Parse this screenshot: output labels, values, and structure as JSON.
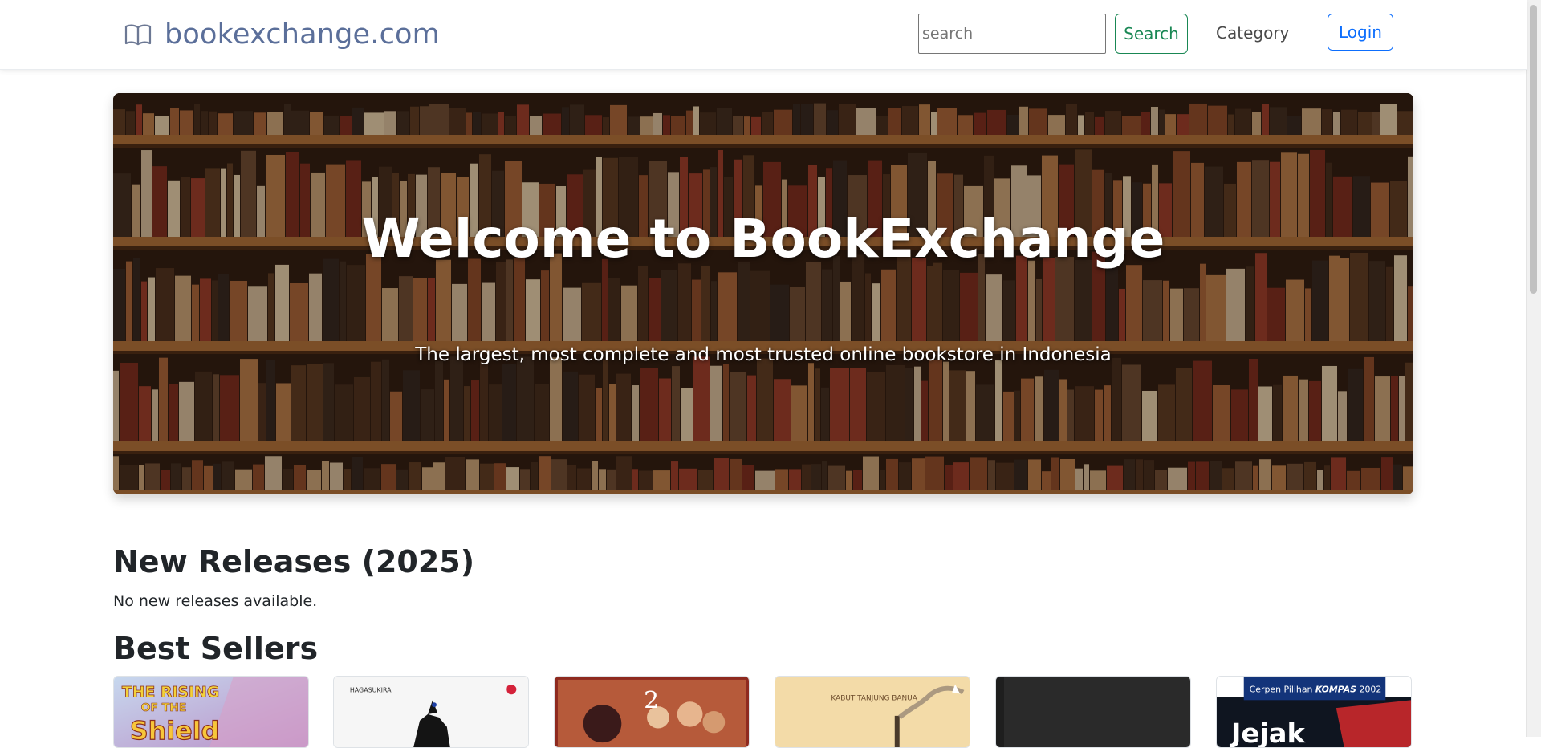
{
  "navbar": {
    "brand_icon": "open-book-icon",
    "brand_name": "bookexchange.com",
    "search_placeholder": "search",
    "search_button": "Search",
    "category_link": "Category",
    "login_button": "Login",
    "brand_color": "#5b6f9a",
    "search_color": "#198754",
    "login_color": "#0d6efd"
  },
  "hero": {
    "title": "Welcome to BookExchange",
    "subtitle": "The largest, most complete and most trusted online bookstore in Indonesia"
  },
  "new_releases": {
    "heading": "New Releases (2025)",
    "empty_message": "No new releases available."
  },
  "best_sellers": {
    "heading": "Best Sellers",
    "books": [
      {
        "cover_text": "THE RISING OF THE SHIELD HERO",
        "cover_color": "#9fb4d6"
      },
      {
        "cover_text": "HAGASUKIRA",
        "cover_color": "#f4f4f4"
      },
      {
        "cover_text": "2",
        "cover_color": "#8a1e1e"
      },
      {
        "cover_text": "KABUT TANJUNG BANUA",
        "cover_color": "#f2d9a4"
      },
      {
        "cover_text": "",
        "cover_color": "#2b2b2b"
      },
      {
        "cover_text": "Cerpen Pilihan KOMPAS 2002",
        "cover_title": "Jejak",
        "cover_color": "#101820"
      }
    ]
  }
}
